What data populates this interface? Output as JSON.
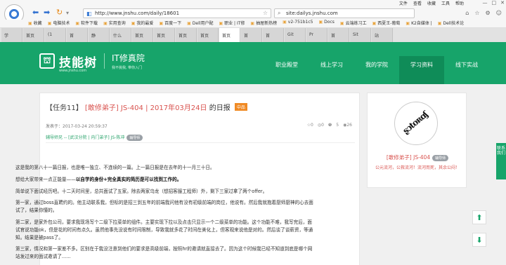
{
  "browser": {
    "menu": [
      "文件",
      "查看",
      "收藏",
      "工具",
      "帮助"
    ],
    "window_controls": [
      "—",
      "□",
      "✕"
    ],
    "back_icon": "back-arrow-icon",
    "forward_icon": "forward-arrow-icon",
    "refresh_icon": "refresh-icon",
    "address": "http://www.jnshu.com/daily/18601",
    "search_query": "site:dailys.jnshu.com",
    "bookmarks": [
      "收藏",
      "电脑技术",
      "软件下载",
      "实用查询",
      "我的最爱",
      "百度一下",
      "Dell用户配",
      "职业 | IT修",
      "抽屉新热榜",
      "v2-751b1c5",
      "Docs",
      "云端练习工",
      "西夏王-葡萄",
      "K2自媒体 |",
      "Dell技术论"
    ],
    "tabs": [
      "学",
      "首页",
      "(1",
      "首",
      "静",
      "什么",
      "首页",
      "首页",
      "首页",
      "首页",
      "首页",
      "首",
      "首",
      "Git",
      "Pr",
      "首",
      "Sit",
      "站"
    ]
  },
  "site": {
    "logo_text": "技能树",
    "logo_url": "www.jnshu.com",
    "logo_sub": "IT修真院",
    "logo_slogan": "我不挑我, 带你入门",
    "nav": [
      "职业殿堂",
      "线上学习",
      "我的学院",
      "学习资料",
      "线下实战"
    ],
    "nav_active_index": 3
  },
  "article": {
    "task": "【任务11】",
    "title_red": "[敢修弟子] JS-404 | 2017年03月24日",
    "title_tail": "的日报",
    "level_badge": "中品",
    "posted": "发表于：2017-03-24 20:59:37",
    "stats": [
      "☆0",
      "◎0",
      "❺",
      "5",
      "◉26"
    ],
    "tags": "辅导师兄 -- ",
    "tag_links": "[武汉分院 | 内门弟子] JS-陈冲",
    "tag_pill": "辅导师",
    "paragraphs": [
      "这是我的第八十一篇日报，也是唯一独立、不连续的一篇。上一篇日报是在去年的十一月三十日。",
      "想给大家带来一点正能量——",
      "以自学的身份+完全真实的简历是可以找到工作的。",
      "简单说下面试经历吧。十二天时间里，总共面试了五家。除去两家乌龙（想招客服工程师）外，剩下三家过拿了两个offer。",
      "第一家，通过boss直聘约的。他主动联系我，但标的是招三到五年的前端我问他有没有初级前端的岗位，他说有。然后我就抱着厨师厨神的心去面试了，结果你懂的。",
      "第二家，是家外包公司，要求我现场写个二级下拉菜单的组件。主要实现下拉以及点击只显示一个二级菜单的功能。这个功能不难，我写完后，面试官说功能ok，但是花的时间有点久。虽然他事先没说有时间限制，导致我就多花了时间在美化上，但客观来说他是对的。然后谈了谈薪资，等通知。结果是被pass了。",
      "第三家，情况和第一家差不多。区别在于我没注意到他们的要求是高级前端，按照hr的邀请就直接去了。因为这个时候我已经不知道到底是哪个网站发过来的面试邀请了......"
    ]
  },
  "author": {
    "name": "[敢修弟子] JS-404",
    "pill": "辅导师",
    "signature": "公元流河，公救流河！流河而死，其余公闷！",
    "avatar_text": "ʂɔtoʀɑʃ"
  },
  "floating": {
    "up_icon": "arrow-up-icon",
    "down_icon": "arrow-down-icon",
    "side_tab": "联系我们"
  }
}
